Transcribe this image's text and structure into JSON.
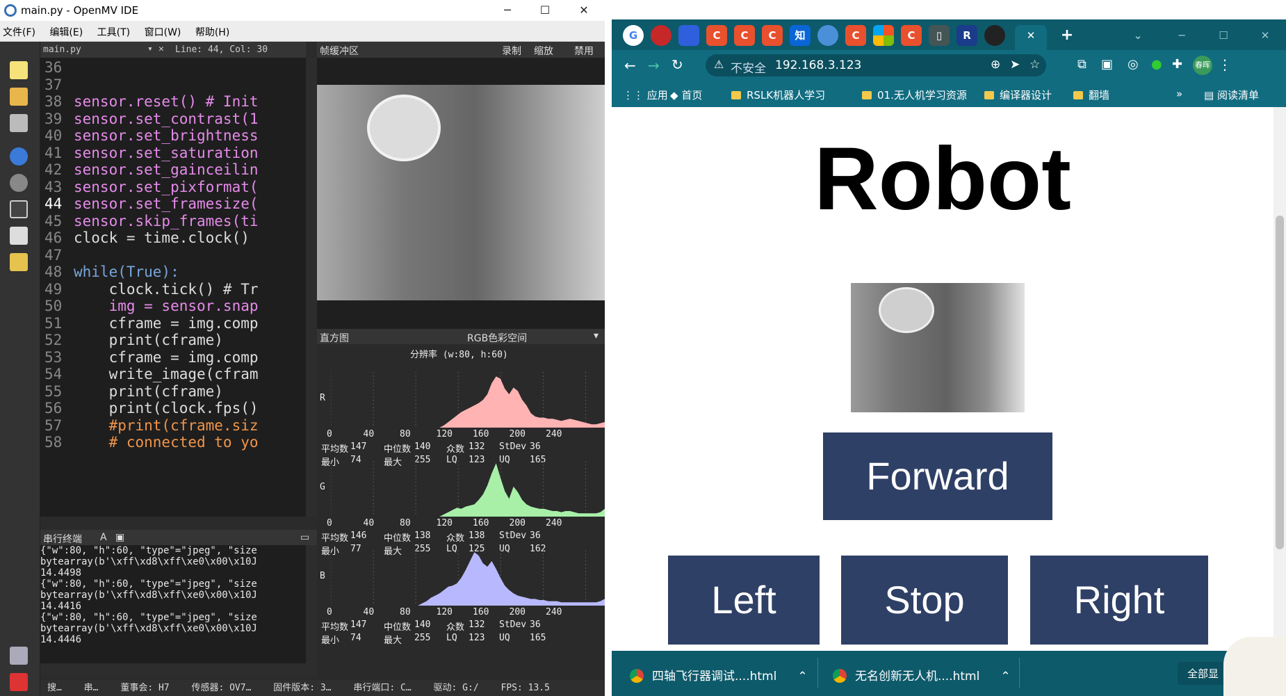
{
  "omv": {
    "title": "main.py - OpenMV IDE",
    "menu": [
      "文件(F)",
      "编辑(E)",
      "工具(T)",
      "窗口(W)",
      "帮助(H)"
    ],
    "editor": {
      "filename": "main.py",
      "position": "Line: 44, Col: 30",
      "lines": [
        {
          "n": "36",
          "code": ""
        },
        {
          "n": "37",
          "code": ""
        },
        {
          "n": "38",
          "code": "sensor.reset() # Init"
        },
        {
          "n": "39",
          "code": "sensor.set_contrast(1"
        },
        {
          "n": "40",
          "code": "sensor.set_brightness"
        },
        {
          "n": "41",
          "code": "sensor.set_saturation"
        },
        {
          "n": "42",
          "code": "sensor.set_gainceilin"
        },
        {
          "n": "43",
          "code": "sensor.set_pixformat("
        },
        {
          "n": "44",
          "code": "sensor.set_framesize("
        },
        {
          "n": "45",
          "code": "sensor.skip_frames(ti"
        },
        {
          "n": "46",
          "code": "clock = time.clock()"
        },
        {
          "n": "47",
          "code": ""
        },
        {
          "n": "48",
          "code": "while(True):"
        },
        {
          "n": "49",
          "code": "    clock.tick() # Tr"
        },
        {
          "n": "50",
          "code": "    img = sensor.snap"
        },
        {
          "n": "51",
          "code": "    cframe = img.comp"
        },
        {
          "n": "52",
          "code": "    print(cframe)"
        },
        {
          "n": "53",
          "code": "    cframe = img.comp"
        },
        {
          "n": "54",
          "code": "    write_image(cfram"
        },
        {
          "n": "55",
          "code": "    print(cframe)"
        },
        {
          "n": "56",
          "code": "    print(clock.fps()"
        },
        {
          "n": "57",
          "code": "    #print(cframe.siz"
        },
        {
          "n": "58",
          "code": "    # connected to yo"
        }
      ]
    },
    "framebuffer": {
      "title": "帧缓冲区",
      "record": "录制",
      "zoom": "缩放",
      "disable": "禁用"
    },
    "histogram": {
      "title": "直方图",
      "colorspace": "RGB色彩空间",
      "resolution": "分辨率 (w:80, h:60)",
      "ticks": [
        "0",
        "40",
        "80",
        "120",
        "160",
        "200",
        "240"
      ],
      "channels": [
        {
          "label": "R",
          "color": "#ffb3b3",
          "mean": "147",
          "median": "140",
          "mode": "132",
          "stdev": "36",
          "min": "74",
          "max": "255",
          "lq": "123",
          "uq": "165"
        },
        {
          "label": "G",
          "color": "#a8f0a8",
          "mean": "146",
          "median": "138",
          "mode": "138",
          "stdev": "36",
          "min": "77",
          "max": "255",
          "lq": "125",
          "uq": "162"
        },
        {
          "label": "B",
          "color": "#b8b8ff",
          "mean": "147",
          "median": "140",
          "mode": "132",
          "stdev": "36",
          "min": "74",
          "max": "255",
          "lq": "123",
          "uq": "165"
        }
      ],
      "stat_labels": {
        "mean": "平均数",
        "median": "中位数",
        "mode": "众数",
        "stdev": "StDev",
        "min": "最小",
        "max": "最大",
        "lq": "LQ",
        "uq": "UQ"
      }
    },
    "terminal": {
      "title": "串行终端",
      "text": "{\"w\":80, \"h\":60, \"type\"=\"jpeg\", \"size\nbytearray(b'\\xff\\xd8\\xff\\xe0\\x00\\x10J\n14.4498\n{\"w\":80, \"h\":60, \"type\"=\"jpeg\", \"size\nbytearray(b'\\xff\\xd8\\xff\\xe0\\x00\\x10J\n14.4416\n{\"w\":80, \"h\":60, \"type\"=\"jpeg\", \"size\nbytearray(b'\\xff\\xd8\\xff\\xe0\\x00\\x10J\n14.4446"
    },
    "status": [
      "搜…",
      "串…",
      "董事会: H7",
      "传感器: OV7…",
      "固件版本: 3…",
      "串行端口: C…",
      "驱动: G:/",
      "FPS: 13.5"
    ]
  },
  "chrome": {
    "tabs": [
      "C",
      "C",
      "C",
      "知",
      "C",
      "C",
      "R"
    ],
    "insecure": "不安全",
    "url": "192.168.3.123",
    "profile": "春晖",
    "bookmarks": [
      "应用",
      "首页",
      "RSLK机器人学习",
      "01.无人机学习资源",
      "编译器设计",
      "翻墙"
    ],
    "reading_list": "阅读清单",
    "more": "»",
    "page": {
      "title": "Robot",
      "buttons": {
        "forward": "Forward",
        "left": "Left",
        "stop": "Stop",
        "right": "Right"
      }
    },
    "downloads": [
      "四轴飞行器调试....html",
      "无名创新无人机....html"
    ],
    "show_all": "全部显"
  }
}
